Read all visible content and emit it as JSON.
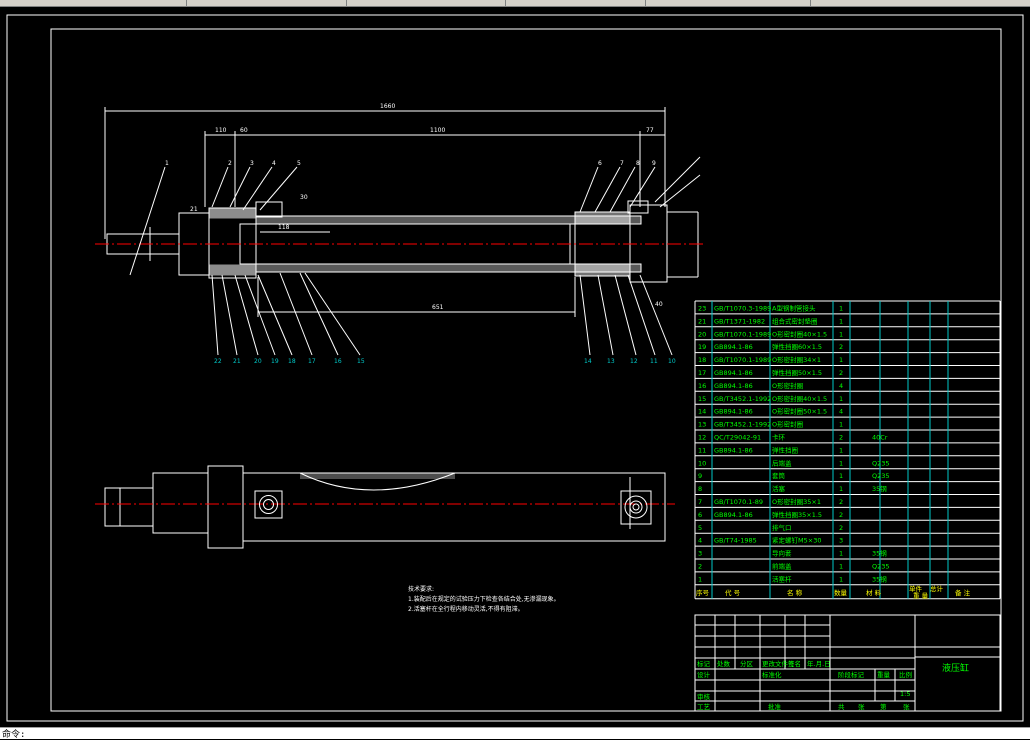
{
  "app": {
    "status_text": "命令:"
  },
  "colors": {
    "background": "#000000",
    "line": "#ffffff",
    "green": "#00ff00",
    "cyan": "#00c8c8",
    "yellow": "#ffff00",
    "magenta": "#ff00ff"
  },
  "drawing": {
    "dims": {
      "overall": "1660",
      "d110": "110",
      "d60": "60",
      "d1100": "1100",
      "d77": "77",
      "d651": "651",
      "d118": "118",
      "d21": "21",
      "d30": "30",
      "d40": "40"
    },
    "balloons_top": [
      "1",
      "2",
      "3",
      "4",
      "5",
      "6",
      "7",
      "8",
      "9"
    ],
    "balloons_bottom": [
      "22",
      "21",
      "20",
      "19",
      "18",
      "17",
      "16",
      "15",
      "14",
      "13",
      "12",
      "11",
      "10"
    ],
    "tech_notes": {
      "title": "技术要求:",
      "line1": "1.装配后在规定的试验压力下检查各结合处,无渗漏现象。",
      "line2": "2.活塞杆在全行程内移动灵活,不得有阻滞。"
    }
  },
  "bom": {
    "rows": [
      {
        "no": "23",
        "code": "GB/T1070.3-1989",
        "name": "A型钢制管接头",
        "qty": "1",
        "mat": ""
      },
      {
        "no": "21",
        "code": "GB/T1371-1982",
        "name": "组合式密封垫圈",
        "qty": "1",
        "mat": ""
      },
      {
        "no": "20",
        "code": "GB/T1070.1-1989",
        "name": "O形密封圈40×1.5",
        "qty": "1",
        "mat": ""
      },
      {
        "no": "19",
        "code": "GB894.1-86",
        "name": "弹性挡圈60×1.5",
        "qty": "2",
        "mat": ""
      },
      {
        "no": "18",
        "code": "GB/T1070.1-1989",
        "name": "O形密封圈34×1",
        "qty": "1",
        "mat": ""
      },
      {
        "no": "17",
        "code": "GB894.1-86",
        "name": "弹性挡圈50×1.5",
        "qty": "2",
        "mat": ""
      },
      {
        "no": "16",
        "code": "GB894.1-86",
        "name": "O形密封圈",
        "qty": "4",
        "mat": ""
      },
      {
        "no": "15",
        "code": "GB/T3452.1-1992",
        "name": "O形密封圈40×1.5",
        "qty": "1",
        "mat": ""
      },
      {
        "no": "14",
        "code": "GB894.1-86",
        "name": "O形密封圈50×1.5",
        "qty": "4",
        "mat": ""
      },
      {
        "no": "13",
        "code": "GB/T3452.1-1992",
        "name": "O形密封圈",
        "qty": "1",
        "mat": ""
      },
      {
        "no": "12",
        "code": "QC/T29042-91",
        "name": "卡环",
        "qty": "2",
        "mat": "40Cr"
      },
      {
        "no": "11",
        "code": "GB894.1-86",
        "name": "弹性挡圈",
        "qty": "1",
        "mat": ""
      },
      {
        "no": "10",
        "code": "",
        "name": "后端盖",
        "qty": "1",
        "mat": "Q235"
      },
      {
        "no": "9",
        "code": "",
        "name": "套筒",
        "qty": "1",
        "mat": "Q235"
      },
      {
        "no": "8",
        "code": "",
        "name": "活塞",
        "qty": "1",
        "mat": "35钢"
      },
      {
        "no": "7",
        "code": "GB/T1070.1-89",
        "name": "O形密封圈35×1",
        "qty": "2",
        "mat": ""
      },
      {
        "no": "6",
        "code": "GB894.1-86",
        "name": "弹性挡圈35×1.5",
        "qty": "2",
        "mat": ""
      },
      {
        "no": "5",
        "code": "",
        "name": "排气口",
        "qty": "2",
        "mat": ""
      },
      {
        "no": "4",
        "code": "GB/T74-1985",
        "name": "紧定螺钉M5×30",
        "qty": "3",
        "mat": ""
      },
      {
        "no": "3",
        "code": "",
        "name": "导向套",
        "qty": "1",
        "mat": "35钢"
      },
      {
        "no": "2",
        "code": "",
        "name": "前端盖",
        "qty": "1",
        "mat": "Q235"
      },
      {
        "no": "1",
        "code": "",
        "name": "活塞杆",
        "qty": "1",
        "mat": "35钢"
      }
    ],
    "header": {
      "no": "序号",
      "code": "代 号",
      "name": "名 称",
      "qty": "数量",
      "mat": "材 料",
      "weight_single": "单件",
      "weight_total": "总计",
      "weight": "重 量",
      "remark": "备 注"
    }
  },
  "titleblock": {
    "title": "液压缸",
    "mark": "标记",
    "count": "处数",
    "zone": "分区",
    "change_doc": "更改文件号",
    "sign": "签名",
    "date": "年.月.日",
    "design": "设计",
    "standard": "标准化",
    "stage": "阶段标记",
    "weight": "重量",
    "scale": "比例",
    "scale_value": "1:5",
    "review": "审核",
    "process": "工艺",
    "approve": "批准",
    "total": "共",
    "sheets": "张",
    "sheet_no": "第",
    "sheet": "张"
  }
}
